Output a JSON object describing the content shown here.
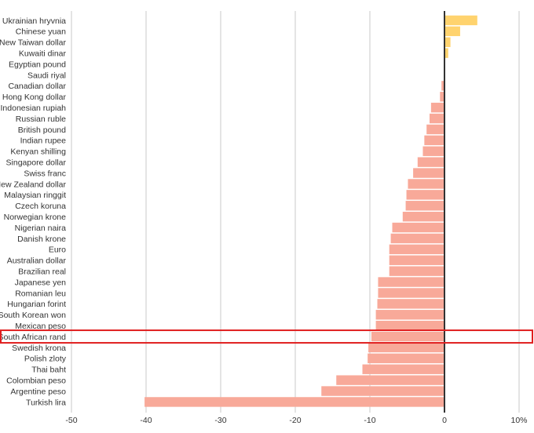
{
  "chart_data": {
    "type": "bar",
    "orientation": "horizontal",
    "title": "",
    "xlabel": "",
    "ylabel": "",
    "xlim": [
      -50,
      10
    ],
    "x_ticks": [
      -50,
      -40,
      -30,
      -20,
      -10,
      0,
      10
    ],
    "x_tick_labels": [
      "-50",
      "-40",
      "-30",
      "-20",
      "-10",
      "0",
      "10%"
    ],
    "grid": true,
    "legend": "none",
    "colors": {
      "positive": "#ffd36e",
      "negative": "#f8a999",
      "zero_line": "#333333",
      "highlight_box": "#e02020"
    },
    "highlighted_category": "South African rand",
    "categories": [
      "Ukrainian hryvnia",
      "Chinese yuan",
      "New Taiwan dollar",
      "Kuwaiti dinar",
      "Egyptian pound",
      "Saudi riyal",
      "Canadian dollar",
      "Hong Kong dollar",
      "Indonesian rupiah",
      "Russian ruble",
      "British pound",
      "Indian rupee",
      "Kenyan shilling",
      "Singapore dollar",
      "Swiss franc",
      "New Zealand dollar",
      "Malaysian ringgit",
      "Czech koruna",
      "Norwegian krone",
      "Nigerian naira",
      "Danish krone",
      "Euro",
      "Australian dollar",
      "Brazilian real",
      "Japanese yen",
      "Romanian leu",
      "Hungarian forint",
      "South Korean won",
      "Mexican peso",
      "South African rand",
      "Swedish krona",
      "Polish zloty",
      "Thai baht",
      "Colombian peso",
      "Argentine peso",
      "Turkish lira"
    ],
    "values": [
      4.4,
      2.1,
      0.8,
      0.5,
      0.1,
      0.0,
      -0.4,
      -0.6,
      -1.8,
      -2.0,
      -2.4,
      -2.7,
      -2.9,
      -3.6,
      -4.2,
      -4.9,
      -5.1,
      -5.2,
      -5.6,
      -7.0,
      -7.2,
      -7.4,
      -7.4,
      -7.4,
      -8.9,
      -8.9,
      -9.0,
      -9.2,
      -9.2,
      -9.8,
      -10.2,
      -10.3,
      -11.0,
      -14.5,
      -16.5,
      -40.2
    ]
  }
}
